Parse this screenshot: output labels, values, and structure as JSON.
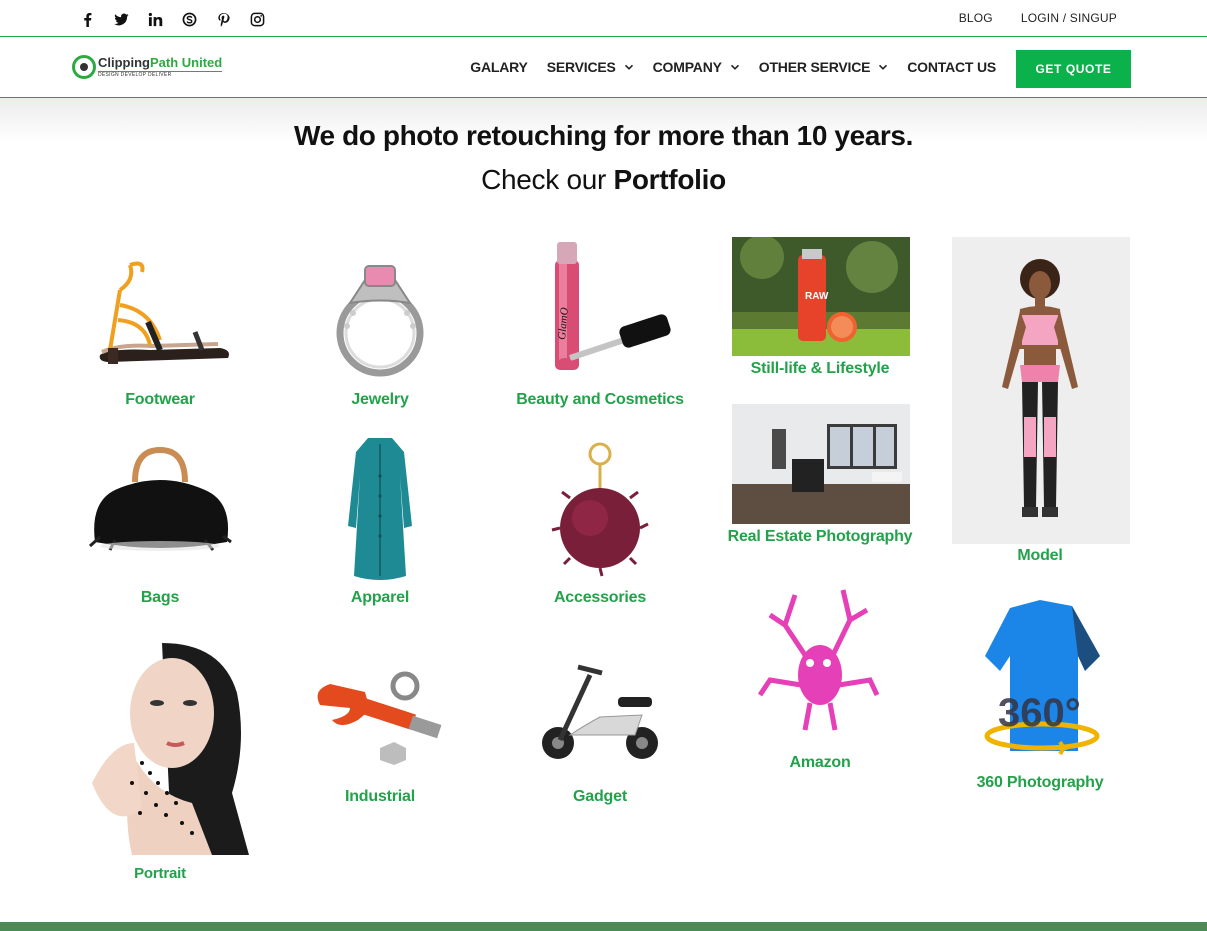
{
  "topbar": {
    "social": [
      "facebook-icon",
      "twitter-icon",
      "linkedin-icon",
      "skype-icon",
      "pinterest-icon",
      "instagram-icon"
    ],
    "links": {
      "blog": "BLOG",
      "login": "LOGIN / SINGUP"
    }
  },
  "header": {
    "logo": {
      "name_part1": "Clipping",
      "name_part2": "Path United",
      "tagline": "DESIGN DEVELOP DELIVER"
    },
    "nav": {
      "galary": "GALARY",
      "services": "SERVICES",
      "company": "COMPANY",
      "other": "OTHER SERVICE",
      "contact": "CONTACT US"
    },
    "quote_button": "GET QUOTE"
  },
  "hero": {
    "title": "We do photo retouching for more than 10 years.",
    "subtitle_prefix": "Check our ",
    "subtitle_bold": "Portfolio"
  },
  "portfolio": {
    "footwear": "Footwear",
    "jewelry": "Jewelry",
    "beauty": "Beauty and Cosmetics",
    "stilllife": "Still-life & Lifestyle",
    "model": "Model",
    "bags": "Bags",
    "apparel": "Apparel",
    "accessories": "Accessories",
    "realestate": "Real Estate Photography",
    "portrait": "Portrait",
    "industrial": "Industrial",
    "gadget": "Gadget",
    "amazon": "Amazon",
    "photo360": "360 Photography",
    "photo360_badge": "360°",
    "lipgloss_brand": "GlamO",
    "bottle_text": "RAW"
  },
  "colors": {
    "brand_green": "#0bb14a",
    "label_green": "#22a24a",
    "line_green": "#1fa34a",
    "footer_green": "#4c8a56"
  }
}
